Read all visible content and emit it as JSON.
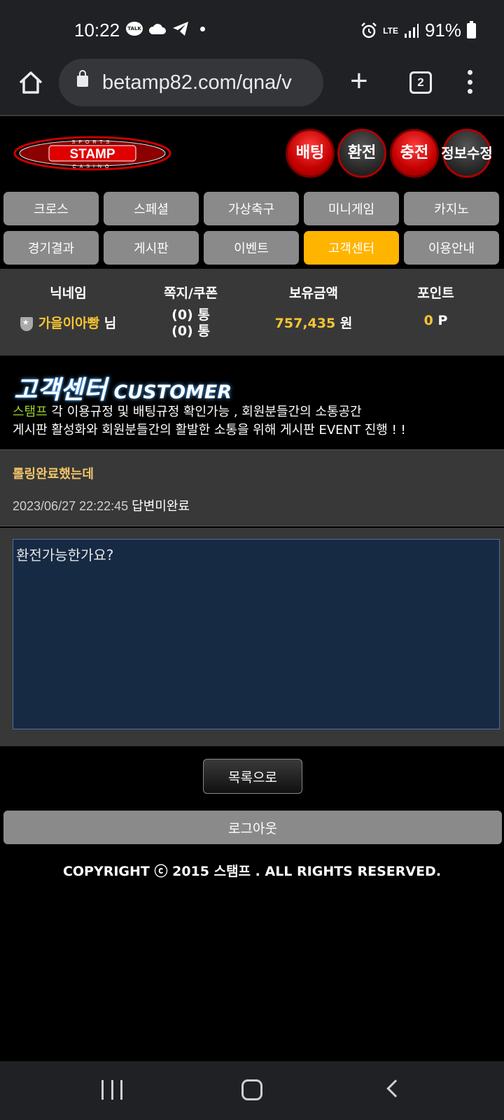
{
  "status_bar": {
    "time": "10:22",
    "talk_label": "TALK",
    "network": "LTE",
    "battery": "91%"
  },
  "browser": {
    "url": "betamp82.com/qna/v",
    "tab_count": "2"
  },
  "header": {
    "logo_top": "SPORTS",
    "logo_main": "STAMP",
    "logo_bottom": "CASINO",
    "buttons": [
      "배팅",
      "환전",
      "충전",
      "정보수정"
    ]
  },
  "menu": {
    "items": [
      "크로스",
      "스페셜",
      "가상축구",
      "미니게임",
      "카지노",
      "경기결과",
      "게시판",
      "이벤트",
      "고객센터",
      "이용안내"
    ],
    "active": "고객센터"
  },
  "user_info": {
    "nickname_label": "닉네임",
    "nickname": "가을이아빵",
    "nickname_suffix": "님",
    "message_label": "쪽지/쿠폰",
    "messages": "(0) 통",
    "coupons": "(0) 통",
    "balance_label": "보유금액",
    "balance": "757,435",
    "balance_unit": "원",
    "points_label": "포인트",
    "points": "0",
    "points_unit": "P"
  },
  "banner": {
    "title_ko": "고객센터",
    "title_en": "CUSTOMER",
    "desc_brand": "스탬프",
    "desc_line1": " 각 이용규정 및 배팅규정 확인가능 , 회원분들간의 소통공간",
    "desc_line2": "게시판 활성화와 회원분들간의 활발한 소통을 위해 게시판 EVENT 진행 ! !"
  },
  "post": {
    "title": "롤링완료했는데",
    "datetime": "2023/06/27 22:22:45",
    "status": "답변미완료",
    "body": "환전가능한가요?"
  },
  "actions": {
    "list_button": "목록으로",
    "logout_button": "로그아웃"
  },
  "footer": {
    "copyright": "COPYRIGHT ⓒ 2015 스탬프 . ALL RIGHTS RESERVED."
  }
}
